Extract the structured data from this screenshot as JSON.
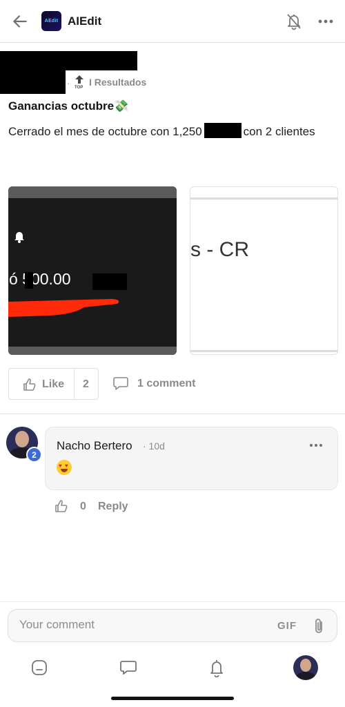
{
  "header": {
    "app_title": "AIEdit",
    "logo_text": "AEdit",
    "back_icon": "arrow-left-icon",
    "notify_icon": "bell-off-icon",
    "more_icon": "more-horizontal-icon"
  },
  "post": {
    "meta_separator": "·",
    "top_badge": "TOP",
    "category": "I Resultados",
    "title": "Ganancias octubre💸",
    "body_before": "Cerrado el mes de octubre con 1,250",
    "body_after": "con 2 clientes",
    "image1_amount": "ó 500.00",
    "image2_text": "s - CR"
  },
  "actions": {
    "like_label": "Like",
    "like_count": "2",
    "comment_label": "1 comment"
  },
  "comment": {
    "author": "Nacho Bertero",
    "time": "· 10d",
    "level": "2",
    "emoji": "😍",
    "like_count": "0",
    "reply_label": "Reply"
  },
  "composer": {
    "placeholder": "Your comment",
    "gif_label": "GIF",
    "attach_icon": "paperclip-icon"
  },
  "bottom_nav": {
    "items": [
      "home-icon",
      "chat-icon",
      "bell-icon",
      "profile-avatar"
    ]
  },
  "colors": {
    "muted_text": "#8a8a8a",
    "level_badge": "#3d6bd6",
    "scribble_red": "#ff2a0a"
  }
}
